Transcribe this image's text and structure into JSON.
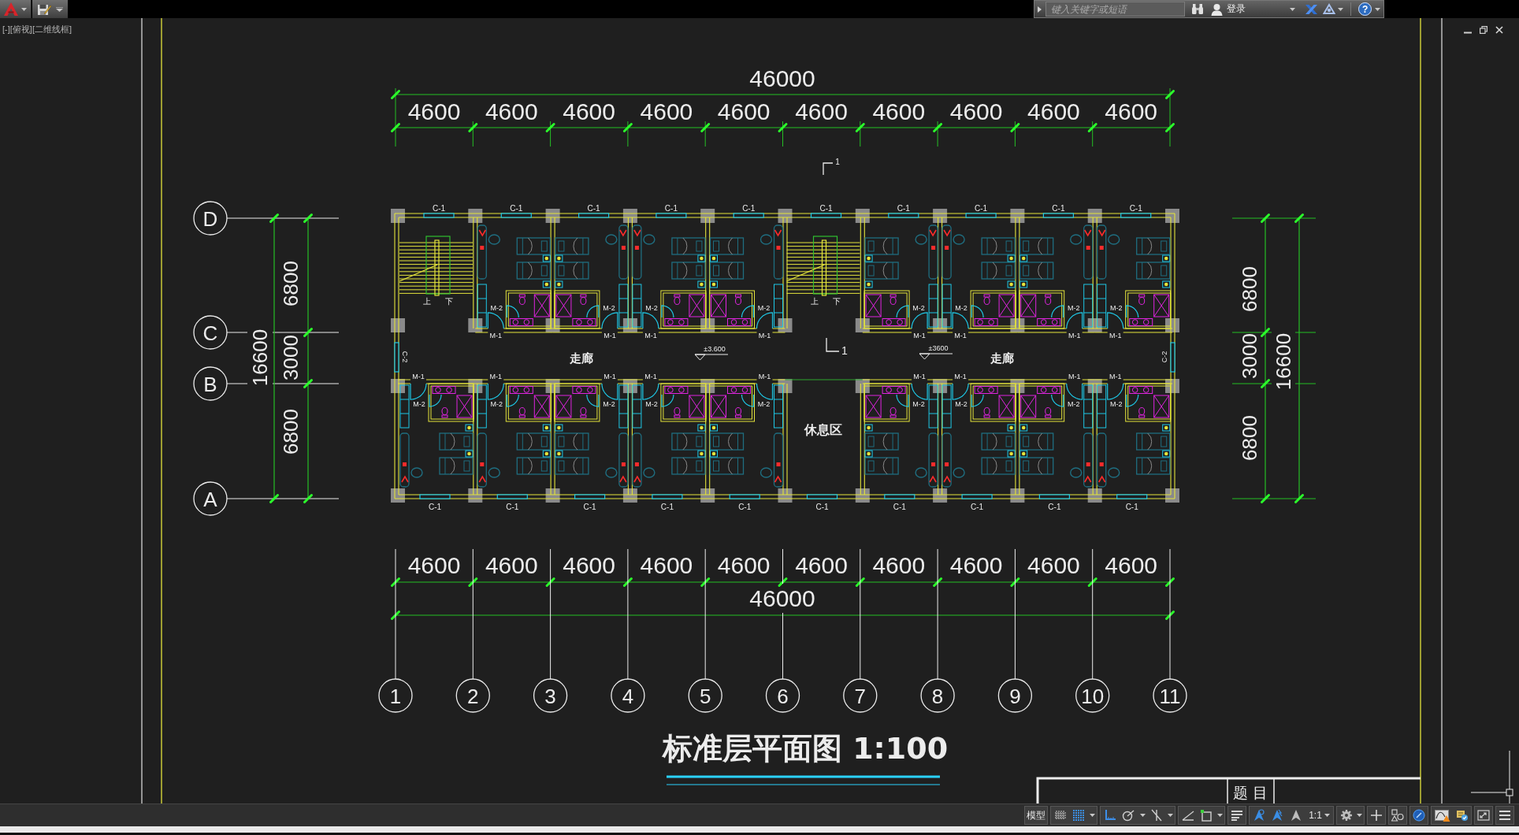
{
  "top_bar": {
    "search": {
      "placeholder": "键入关键字或短语"
    },
    "sign_in": "登录",
    "help": "?"
  },
  "viewport": {
    "controls_label": "[-][俯视][二维线框]"
  },
  "plan": {
    "section_marks": [
      "1",
      "1"
    ],
    "dimensions": {
      "top": {
        "total": "46000",
        "bays": [
          "4600",
          "4600",
          "4600",
          "4600",
          "4600",
          "4600",
          "4600",
          "4600",
          "4600",
          "4600"
        ]
      },
      "left": {
        "spans": [
          "6800",
          "3000",
          "6800"
        ],
        "total": "16600"
      },
      "right": {
        "spans": [
          "6800",
          "3000",
          "6800"
        ],
        "total": "16600"
      },
      "bottom": {
        "bays": [
          "4600",
          "4600",
          "4600",
          "4600",
          "4600",
          "4600",
          "4600",
          "4600",
          "4600",
          "4600"
        ],
        "total": "46000"
      }
    },
    "row_axes": [
      "D",
      "C",
      "B",
      "A"
    ],
    "upper_bays": [
      {
        "kind": "stair",
        "window": "C-1",
        "up": "上",
        "down": "下"
      },
      {
        "kind": "room",
        "window": "C-1",
        "entry_door": "M-1",
        "bath_door": "M-2"
      },
      {
        "kind": "room",
        "window": "C-1",
        "entry_door": "M-1",
        "bath_door": "M-2"
      },
      {
        "kind": "room",
        "window": "C-1",
        "entry_door": "M-1",
        "bath_door": "M-2"
      },
      {
        "kind": "room",
        "window": "C-1",
        "entry_door": "M-1",
        "bath_door": "M-2"
      },
      {
        "kind": "stair",
        "window": "C-1",
        "up": "上",
        "down": "下"
      },
      {
        "kind": "room",
        "window": "C-1",
        "entry_door": "M-1",
        "bath_door": "M-2"
      },
      {
        "kind": "room",
        "window": "C-1",
        "entry_door": "M-1",
        "bath_door": "M-2"
      },
      {
        "kind": "room",
        "window": "C-1",
        "entry_door": "M-1",
        "bath_door": "M-2"
      },
      {
        "kind": "room",
        "window": "C-1",
        "entry_door": "M-1",
        "bath_door": "M-2"
      }
    ],
    "end_windows": [
      "C-2",
      "C-2"
    ],
    "corridor_labels": [
      "走廊",
      "走廊"
    ],
    "level_marks": [
      "±3.600",
      "±3600"
    ],
    "lower_bays": [
      {
        "kind": "room",
        "window": "C-1",
        "entry_door": "M-1",
        "bath_door": "M-2"
      },
      {
        "kind": "room",
        "window": "C-1",
        "entry_door": "M-1",
        "bath_door": "M-2"
      },
      {
        "kind": "room",
        "window": "C-1",
        "entry_door": "M-1",
        "bath_door": "M-2"
      },
      {
        "kind": "room",
        "window": "C-1",
        "entry_door": "M-1",
        "bath_door": "M-2"
      },
      {
        "kind": "room",
        "window": "C-1",
        "entry_door": "M-1",
        "bath_door": "M-2"
      },
      {
        "kind": "lounge",
        "window": "C-1",
        "name": "休息区"
      },
      {
        "kind": "room",
        "window": "C-1",
        "entry_door": "M-1",
        "bath_door": "M-2"
      },
      {
        "kind": "room",
        "window": "C-1",
        "entry_door": "M-1",
        "bath_door": "M-2"
      },
      {
        "kind": "room",
        "window": "C-1",
        "entry_door": "M-1",
        "bath_door": "M-2"
      },
      {
        "kind": "room",
        "window": "C-1",
        "entry_door": "M-1",
        "bath_door": "M-2"
      }
    ],
    "column_axes": [
      "1",
      "2",
      "3",
      "4",
      "5",
      "6",
      "7",
      "8",
      "9",
      "10",
      "11"
    ]
  },
  "drawing_title": "标准层平面图 1:100",
  "title_block": {
    "label": "题 目"
  },
  "status_bar": {
    "model_tab": "模型",
    "annotation_scale": "1:1"
  }
}
